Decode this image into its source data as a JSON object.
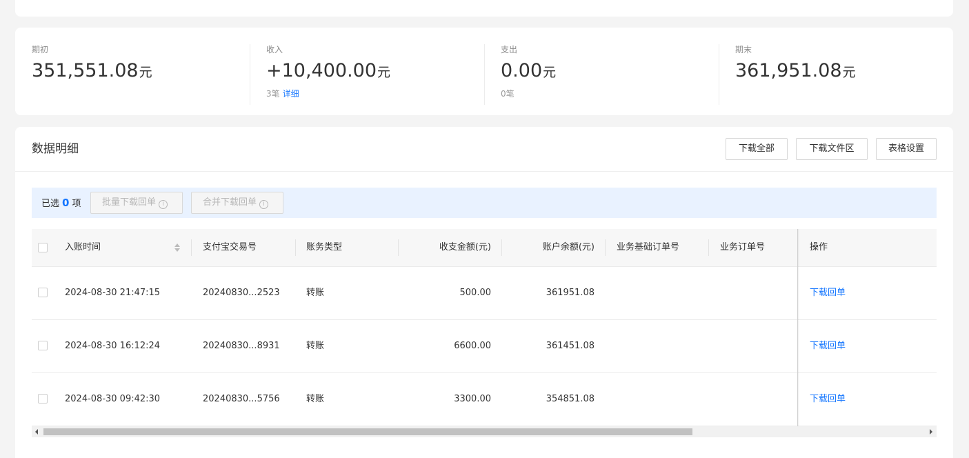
{
  "summary": {
    "opening": {
      "label": "期初",
      "amount": "351,551.08",
      "unit": "元"
    },
    "income": {
      "label": "收入",
      "amount": "+10,400.00",
      "unit": "元",
      "count": "3笔",
      "detail_link": "详细"
    },
    "expense": {
      "label": "支出",
      "amount": "0.00",
      "unit": "元",
      "count": "0笔"
    },
    "closing": {
      "label": "期末",
      "amount": "361,951.08",
      "unit": "元"
    }
  },
  "detail": {
    "title": "数据明细",
    "buttons": {
      "download_all": "下载全部",
      "download_files": "下载文件区",
      "table_settings": "表格设置"
    },
    "selection": {
      "prefix": "已选",
      "count": "0",
      "suffix": "项",
      "batch_download": "批量下载回单",
      "merge_download": "合并下载回单",
      "info_glyph": "i"
    },
    "columns": {
      "time": "入账时间",
      "trade_no": "支付宝交易号",
      "type": "账务类型",
      "amount": "收支金额(元)",
      "balance": "账户余额(元)",
      "base_order": "业务基础订单号",
      "order": "业务订单号",
      "action": "操作"
    },
    "rows": [
      {
        "time": "2024-08-30 21:47:15",
        "trade_no": "20240830...2523",
        "type": "转账",
        "amount": "500.00",
        "balance": "361951.08",
        "action": "下载回单"
      },
      {
        "time": "2024-08-30 16:12:24",
        "trade_no": "20240830...8931",
        "type": "转账",
        "amount": "6600.00",
        "balance": "361451.08",
        "action": "下载回单"
      },
      {
        "time": "2024-08-30 09:42:30",
        "trade_no": "20240830...5756",
        "type": "转账",
        "amount": "3300.00",
        "balance": "354851.08",
        "action": "下载回单"
      }
    ]
  },
  "colors": {
    "accent": "#1677ff",
    "selection_bg": "#e9f2ff",
    "page_bg": "#f4f4f4"
  }
}
